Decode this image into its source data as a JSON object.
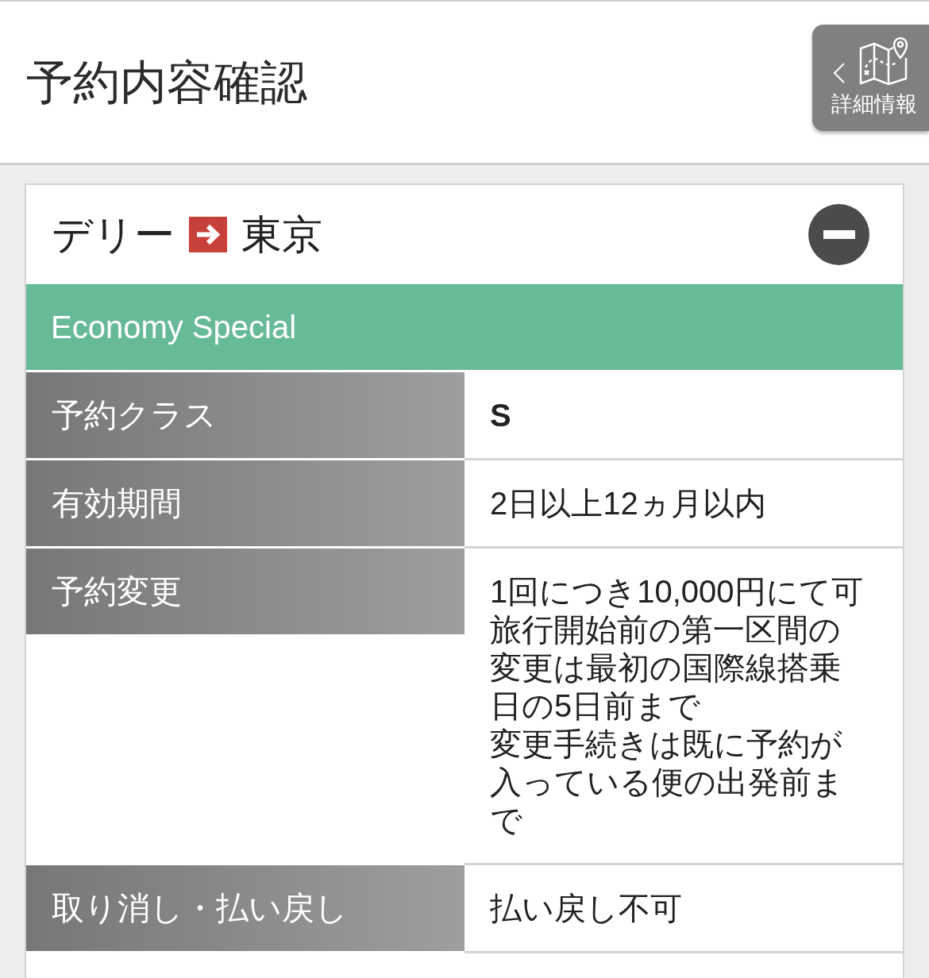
{
  "header": {
    "title": "予約内容確認",
    "detail_button": {
      "label": "詳細情報"
    }
  },
  "route": {
    "origin": "デリー",
    "destination": "東京",
    "expanded": true
  },
  "fare": {
    "name": "Economy Special"
  },
  "rows": [
    {
      "label": "予約クラス",
      "value_lines": [
        "S"
      ],
      "emphasized": true
    },
    {
      "label": "有効期間",
      "value_lines": [
        "2日以上12ヵ月以内"
      ],
      "emphasized": false
    },
    {
      "label": "予約変更",
      "value_lines": [
        "1回につき10,000円にて可",
        "旅行開始前の第一区間の",
        "変更は最初の国際線搭乗",
        "日の5日前まで",
        "変更手続きは既に予約が",
        "入っている便の出発前ま",
        "で"
      ],
      "emphasized": false
    },
    {
      "label": "取り消し・払い戻し",
      "value_lines": [
        "払い戻し不可"
      ],
      "emphasized": false
    }
  ]
}
